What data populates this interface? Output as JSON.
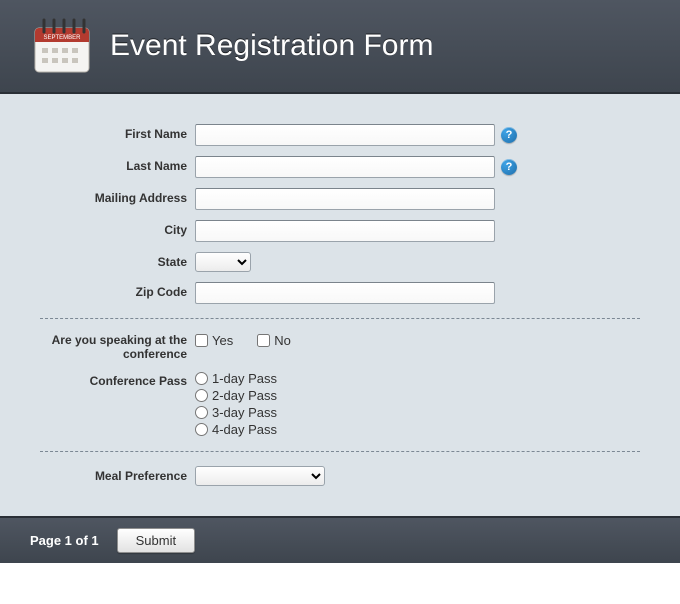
{
  "header": {
    "title": "Event Registration Form"
  },
  "labels": {
    "firstName": "First Name",
    "lastName": "Last Name",
    "address": "Mailing Address",
    "city": "City",
    "state": "State",
    "zip": "Zip Code",
    "speaking": "Are you speaking at the conference",
    "pass": "Conference Pass",
    "meal": "Meal Preference"
  },
  "fields": {
    "firstName": "",
    "lastName": "",
    "address": "",
    "city": "",
    "zip": "",
    "stateSelected": "",
    "mealSelected": ""
  },
  "speakingOptions": {
    "yes": "Yes",
    "no": "No"
  },
  "passOptions": {
    "d1": "1-day Pass",
    "d2": "2-day Pass",
    "d3": "3-day Pass",
    "d4": "4-day Pass"
  },
  "footer": {
    "pageIndicator": "Page 1 of 1",
    "submitLabel": "Submit"
  }
}
